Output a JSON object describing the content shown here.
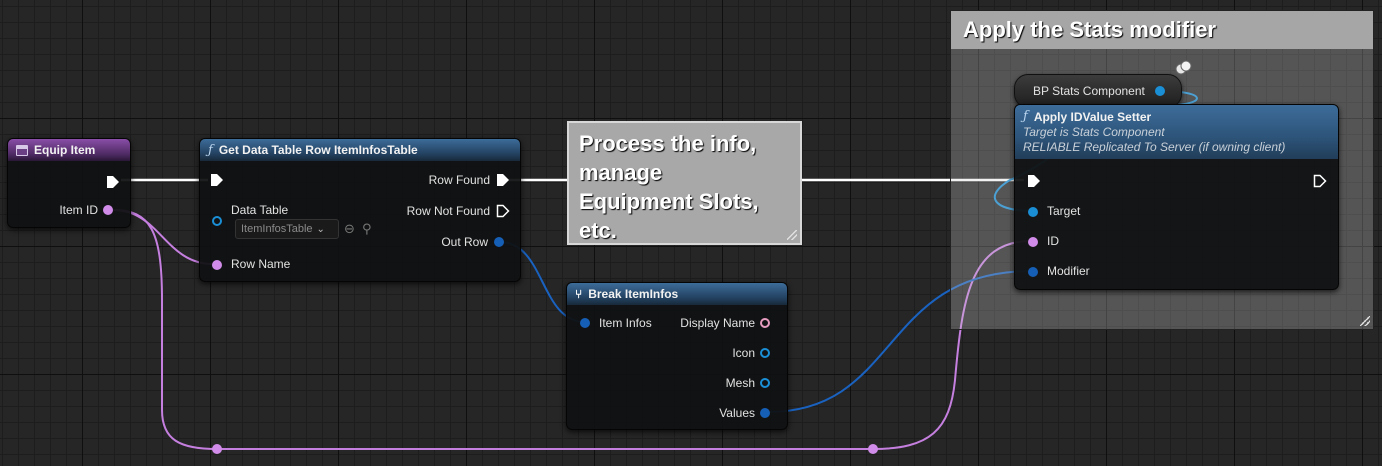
{
  "event_node": {
    "title": "Equip Item",
    "item_id_label": "Item ID"
  },
  "get_row_node": {
    "title": "Get Data Table Row ItemInfosTable",
    "data_table_label": "Data Table",
    "data_table_value": "ItemInfosTable",
    "row_name_label": "Row Name",
    "row_found_label": "Row Found",
    "row_not_found_label": "Row Not Found",
    "out_row_label": "Out Row"
  },
  "process_comment": {
    "text": "Process the info, manage Equipment Slots, etc."
  },
  "break_node": {
    "title": "Break ItemInfos",
    "item_infos_label": "Item Infos",
    "display_name_label": "Display Name",
    "icon_label": "Icon",
    "mesh_label": "Mesh",
    "values_label": "Values"
  },
  "stats_comment": {
    "title": "Apply the Stats modifier"
  },
  "stats_component_node": {
    "label": "BP Stats Component"
  },
  "apply_node": {
    "title": "Apply IDValue Setter",
    "subtitle1": "Target is Stats Component",
    "subtitle2": "RELIABLE Replicated To Server (if owning client)",
    "target_label": "Target",
    "id_label": "ID",
    "modifier_label": "Modifier"
  },
  "colors": {
    "exec": "#ffffff",
    "name_pin": "#d18ce9",
    "object_pin": "#1a8fd6",
    "struct_pin": "#165fb6",
    "text_pin": "#e59cbf"
  }
}
